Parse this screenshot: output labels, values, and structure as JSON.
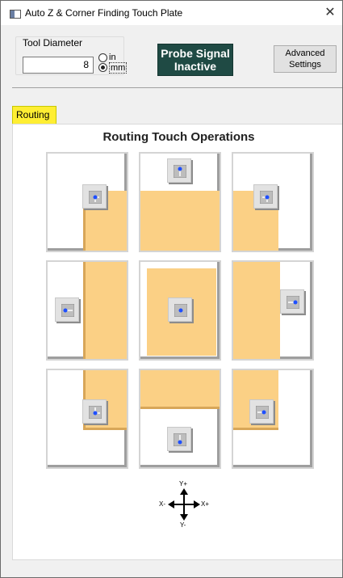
{
  "window": {
    "title": "Auto Z & Corner Finding Touch Plate",
    "close_glyph": "✕"
  },
  "tool_diameter": {
    "label": "Tool Diameter",
    "value": "8",
    "units": [
      {
        "label": "in",
        "selected": false
      },
      {
        "label": "mm",
        "selected": true
      }
    ]
  },
  "probe_signal": {
    "line1": "Probe Signal",
    "line2": "Inactive"
  },
  "advanced_settings": {
    "line1": "Advanced",
    "line2": "Settings"
  },
  "tabs": [
    {
      "label": "Routing",
      "active": true
    }
  ],
  "routing": {
    "title": "Routing Touch Operations",
    "operations": [
      {
        "name": "top-left-corner"
      },
      {
        "name": "top-edge"
      },
      {
        "name": "top-right-corner"
      },
      {
        "name": "left-edge"
      },
      {
        "name": "center"
      },
      {
        "name": "right-edge"
      },
      {
        "name": "bottom-left-corner"
      },
      {
        "name": "bottom-edge"
      },
      {
        "name": "bottom-right-corner"
      }
    ]
  },
  "compass": {
    "y_plus": "Y+",
    "y_minus": "Y-",
    "x_plus": "X+",
    "x_minus": "X-"
  },
  "colors": {
    "material": "#fbd085",
    "material_edge": "#d8a658",
    "probe_signal_bg": "#1f4a44",
    "tab_highlight": "#ffee33",
    "arrow": "#1e4fff"
  }
}
